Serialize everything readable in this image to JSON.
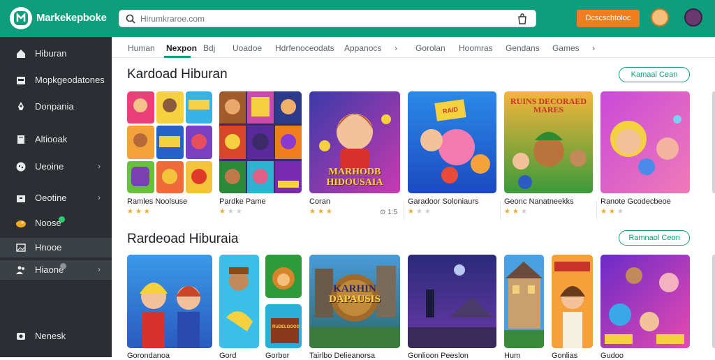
{
  "app": {
    "name": "Markekepboke",
    "search_placeholder": "Hirumkraroe.com",
    "top_button": "Dcscschtoloc",
    "colors": {
      "brand": "#0e9e7c",
      "accent": "#f07e1f",
      "sidebar": "#2b2f33"
    }
  },
  "sidebar": {
    "items": [
      {
        "label": "Hiburan",
        "icon": "home-icon"
      },
      {
        "label": "Mopkgeodatones",
        "icon": "storefront-icon"
      },
      {
        "label": "Donpania",
        "icon": "rocket-icon"
      },
      {
        "label": "Altiooak",
        "icon": "book-icon"
      },
      {
        "label": "Ueoine",
        "icon": "gamepad-icon",
        "chevron": "›"
      },
      {
        "label": "Oeotine",
        "icon": "archive-icon",
        "chevron": "›"
      },
      {
        "label": "Noose",
        "icon": "star-badge-icon"
      },
      {
        "label": "Hnooe",
        "icon": "picture-icon"
      },
      {
        "label": "Hiaone",
        "icon": "people-icon",
        "chevron": "›"
      },
      {
        "label": "Nenesk",
        "icon": "settings-icon"
      }
    ]
  },
  "tabs": [
    "Human",
    "Nexpon",
    "Bdj",
    "Uoadoe",
    "Hdrfenoceodats",
    "Appanocs",
    "›",
    "Gorolan",
    "Hoomras",
    "Gendans",
    "Games",
    "›"
  ],
  "sections": [
    {
      "title": "Kardoad Hiburan",
      "button": "Kamaal Cean",
      "cards": [
        {
          "title": "Ramles Noolsuse",
          "stars": "★★★",
          "dim": ""
        },
        {
          "title": "Pardke Pame",
          "stars": "★",
          "dim": "★★"
        },
        {
          "title": "Coran",
          "stars": "★★★",
          "dim": ""
        },
        {
          "title": "Garadoor Soloniaurs",
          "rating": "⊙ 1:5",
          "stars": "★",
          "dim": "★★"
        },
        {
          "title": "Geonc Nanatneekks",
          "stars": "★★",
          "dim": "★"
        },
        {
          "title": "Ranote Gcodecbeoe",
          "stars": "★★",
          "dim": "★"
        }
      ],
      "featured_art_text": [
        "MARHODB",
        "HIDOUSAIA"
      ],
      "banner_art_text": [
        "RUINS DECORAED",
        "MARES"
      ],
      "badge_art_text": "RAID"
    },
    {
      "title": "Rardeoad Hiburaia",
      "button": "Ramnaol Ceon",
      "cards": [
        {
          "title": "Gorondanoa"
        },
        {
          "title": "Gord"
        },
        {
          "title": "Gorbor"
        },
        {
          "title": "Tairlbo Delieanorsa"
        },
        {
          "title": "Gonlioon Peeslon"
        },
        {
          "title": "Hum"
        },
        {
          "title": "Gonlias"
        },
        {
          "title": "Gudoo"
        }
      ],
      "featured_art_text": [
        "KARHIN",
        "DAPAUSIS"
      ],
      "poster_art_text": "RUDELGOOD"
    }
  ]
}
